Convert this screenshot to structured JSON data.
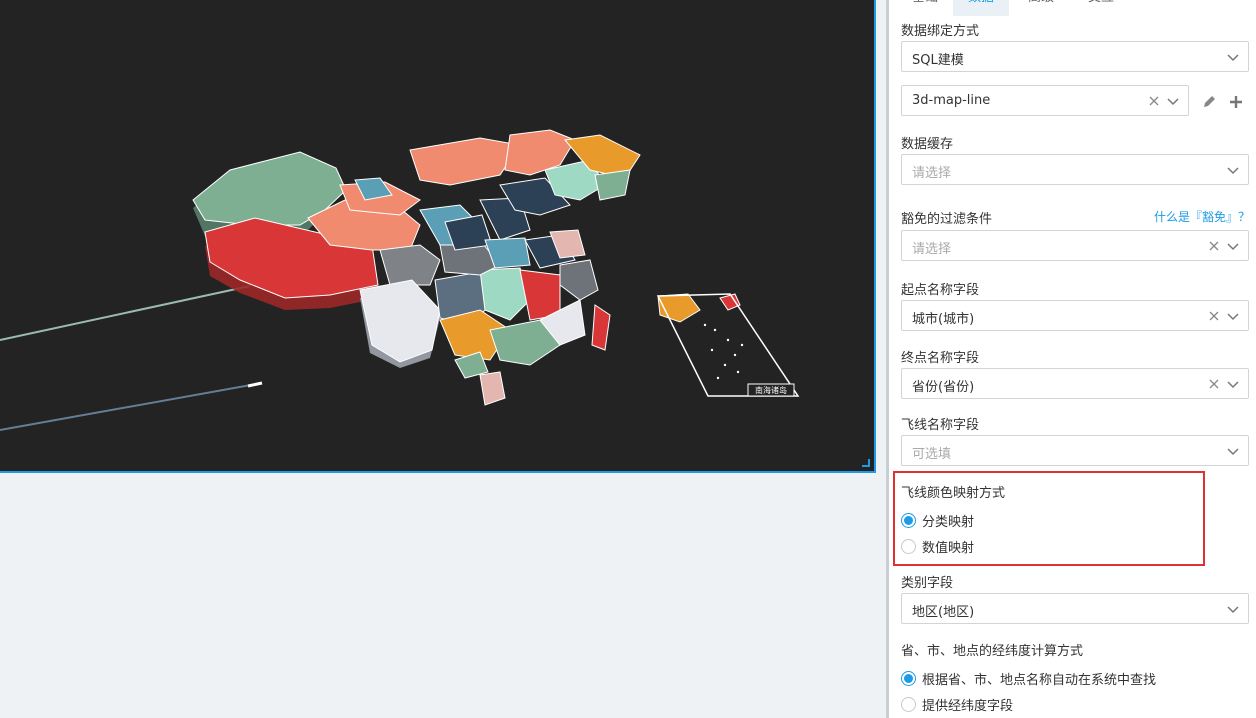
{
  "tabs": [
    "基础",
    "数据",
    "高级",
    "交互"
  ],
  "active_tab": "数据",
  "map": {
    "inset_label": "南海诸岛"
  },
  "form": {
    "binding_label": "数据绑定方式",
    "binding_value": "SQL建模",
    "model_value": "3d-map-line",
    "cache_label": "数据缓存",
    "cache_placeholder": "请选择",
    "filter_label": "豁免的过滤条件",
    "filter_help": "什么是『豁免』？",
    "filter_placeholder": "请选择",
    "start_label": "起点名称字段",
    "start_value": "城市(城市)",
    "end_label": "终点名称字段",
    "end_value": "省份(省份)",
    "line_name_label": "飞线名称字段",
    "line_name_placeholder": "可选填",
    "color_map_label": "飞线颜色映射方式",
    "color_map_options": [
      "分类映射",
      "数值映射"
    ],
    "category_label": "类别字段",
    "category_value": "地区(地区)",
    "coord_label": "省、市、地点的经纬度计算方式",
    "coord_options": [
      "根据省、市、地点名称自动在系统中查找",
      "提供经纬度字段"
    ]
  },
  "colors": {
    "accent": "#1e9be6",
    "highlight": "#e03131",
    "canvas_bg": "#232323"
  }
}
